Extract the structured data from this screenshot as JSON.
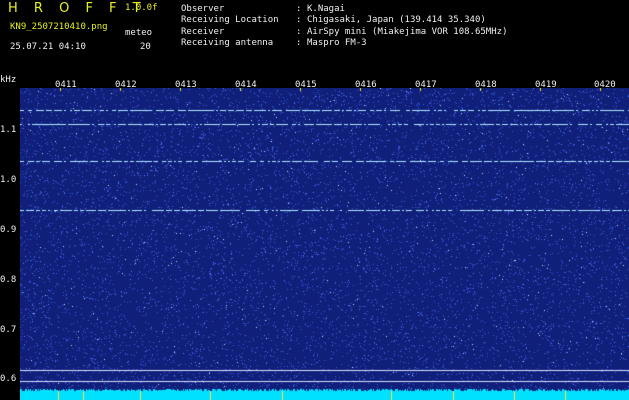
{
  "header": {
    "app_title": "H R O F F T",
    "version": "1.0.0f",
    "file_name": "KN9_2507210410.png",
    "meteor_label": "meteo",
    "meteor_count": "20",
    "datetime": "25.07.21 04:10"
  },
  "meta": [
    {
      "label": "Observer",
      "value": "K.Nagai"
    },
    {
      "label": "Receiving Location",
      "value": "Chigasaki, Japan (139.414 35.340)"
    },
    {
      "label": "Receiver",
      "value": "AirSpy mini (Miakejima VOR 108.65MHz)"
    },
    {
      "label": "Receiving antenna",
      "value": "Maspro FM-3"
    }
  ],
  "meta_separator": ":",
  "axis": {
    "y_unit": "kHz",
    "y_ticks": [
      "1.1",
      "1.0",
      "0.9",
      "0.8",
      "0.7",
      "0.6"
    ],
    "x_ticks": [
      "0411",
      "0412",
      "0413",
      "0414",
      "0415",
      "0416",
      "0417",
      "0418",
      "0419",
      "0420"
    ]
  },
  "colors": {
    "background": "#000000",
    "spectrogram_base": "#10207a",
    "noise": "#3a55d8",
    "carrier": "#b0e8ff",
    "signal_strip": "#00e0ff",
    "title": "#e8f020",
    "text": "#f0f0f0"
  }
}
